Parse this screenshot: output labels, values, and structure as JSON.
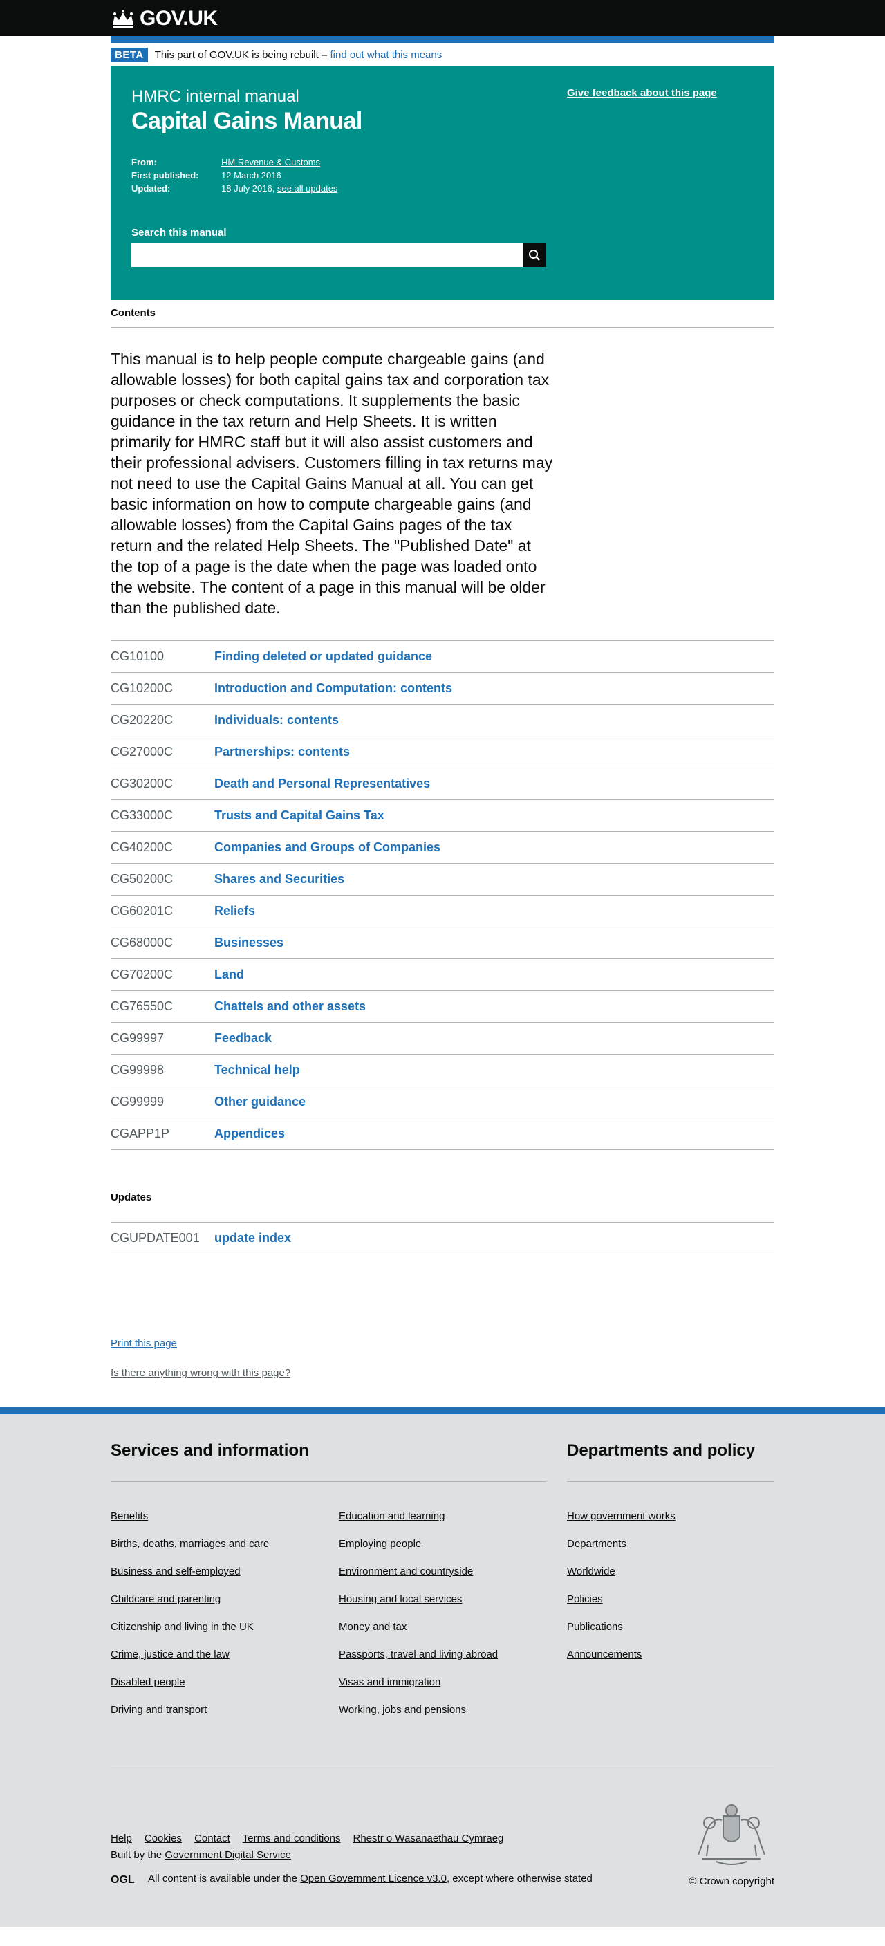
{
  "header": {
    "logo_text": "GOV.UK",
    "logo_icon": "crown-icon"
  },
  "beta": {
    "tag": "BETA",
    "message": "This part of GOV.UK is being rebuilt –",
    "link": "find out what this means"
  },
  "hero": {
    "kicker": "HMRC internal manual",
    "title": "Capital Gains Manual",
    "feedback_link": "Give feedback about this page",
    "meta": {
      "from_label": "From:",
      "from_value": "HM Revenue & Customs",
      "first_published_label": "First published:",
      "first_published_value": "12 March 2016",
      "updated_label": "Updated:",
      "updated_value": "18 July 2016,",
      "updated_link": "see all updates"
    },
    "search": {
      "label": "Search this manual",
      "placeholder": "",
      "button_icon": "search-icon"
    },
    "background_color": "#00918a"
  },
  "contents_heading": "Contents",
  "intro": "This manual is to help people compute chargeable gains (and allowable losses) for both capital gains tax and corporation tax purposes or check computations. It supplements the basic guidance in the tax return and Help Sheets. It is written primarily for HMRC staff but it will also assist customers and their professional advisers. Customers filling in tax returns may not need to use the Capital Gains Manual at all. You can get basic information on how to compute chargeable gains (and allowable losses) from the Capital Gains pages of the tax return and the related Help Sheets. The \"Published Date\" at the top of a page is the date when the page was loaded onto the website. The content of a page in this manual will be older than the published date.",
  "sections": [
    {
      "id": "CG10100",
      "title": "Finding deleted or updated guidance"
    },
    {
      "id": "CG10200C",
      "title": "Introduction and Computation: contents"
    },
    {
      "id": "CG20220C",
      "title": "Individuals: contents"
    },
    {
      "id": "CG27000C",
      "title": "Partnerships: contents"
    },
    {
      "id": "CG30200C",
      "title": "Death and Personal Representatives"
    },
    {
      "id": "CG33000C",
      "title": "Trusts and Capital Gains Tax"
    },
    {
      "id": "CG40200C",
      "title": "Companies and Groups of Companies"
    },
    {
      "id": "CG50200C",
      "title": "Shares and Securities"
    },
    {
      "id": "CG60201C",
      "title": "Reliefs"
    },
    {
      "id": "CG68000C",
      "title": "Businesses"
    },
    {
      "id": "CG70200C",
      "title": "Land"
    },
    {
      "id": "CG76550C",
      "title": "Chattels and other assets"
    },
    {
      "id": "CG99997",
      "title": "Feedback"
    },
    {
      "id": "CG99998",
      "title": "Technical help"
    },
    {
      "id": "CG99999",
      "title": "Other guidance"
    },
    {
      "id": "CGAPP1P",
      "title": "Appendices"
    }
  ],
  "updates_heading": "Updates",
  "updates": [
    {
      "id": "CGUPDATE001",
      "title": "update index"
    }
  ],
  "page_links": {
    "print": "Print this page",
    "wrong": "Is there anything wrong with this page?"
  },
  "footer": {
    "services_heading": "Services and information",
    "departments_heading": "Departments and policy",
    "services_col1": [
      "Benefits",
      "Births, deaths, marriages and care",
      "Business and self-employed",
      "Childcare and parenting",
      "Citizenship and living in the UK",
      "Crime, justice and the law",
      "Disabled people",
      "Driving and transport"
    ],
    "services_col2": [
      "Education and learning",
      "Employing people",
      "Environment and countryside",
      "Housing and local services",
      "Money and tax",
      "Passports, travel and living abroad",
      "Visas and immigration",
      "Working, jobs and pensions"
    ],
    "departments": [
      "How government works",
      "Departments",
      "Worldwide",
      "Policies",
      "Publications",
      "Announcements"
    ],
    "meta_links": [
      "Help",
      "Cookies",
      "Contact",
      "Terms and conditions",
      "Rhestr o Wasanaethau Cymraeg"
    ],
    "built_by_prefix": "Built by the",
    "built_by_link": "Government Digital Service",
    "ogl_logo": "OGL",
    "licence_prefix": "All content is available under the",
    "licence_link": "Open Government Licence v3.0",
    "licence_suffix": ", except where otherwise stated",
    "copyright": "© Crown copyright",
    "crest_icon": "royal-coat-of-arms-icon"
  }
}
